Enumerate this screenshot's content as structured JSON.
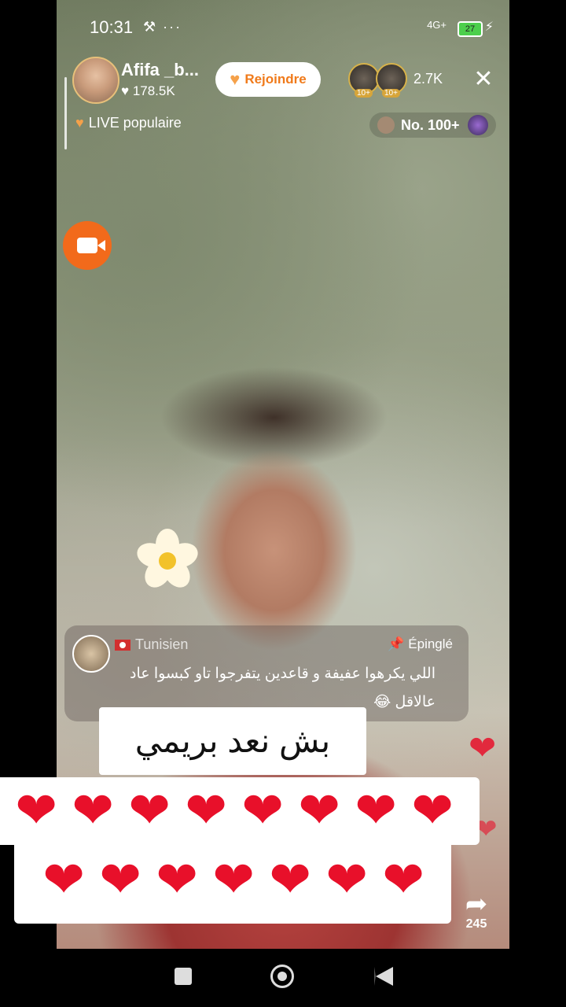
{
  "status_bar": {
    "time": "10:31",
    "icons": "⚒ ···",
    "network": "4G+",
    "battery": "27"
  },
  "host": {
    "name": "Afifa _b...",
    "likes": "♥ 178.5K"
  },
  "join_button": {
    "label": "Rejoindre"
  },
  "viewers": {
    "badge": "10+",
    "count": "2.7K"
  },
  "live_popular": {
    "label": "LIVE populaire"
  },
  "ranking": {
    "label": "No. 100+"
  },
  "pinned_comment": {
    "username": "Tunisien",
    "pinned_label": "Épinglé",
    "text": "اللي يكرهوا عفيفة و قاعدين يتفرجوا تاو كبسوا عاد عالاقل 😂"
  },
  "caption": {
    "text": "بش نعد بريمي"
  },
  "hearts": {
    "glyph": "❤",
    "row1_count": 8,
    "row2_count": 7
  },
  "share": {
    "count": "245"
  },
  "colors": {
    "accent": "#f26a1b",
    "heart": "#e8102a",
    "join_text": "#f07a1a"
  }
}
